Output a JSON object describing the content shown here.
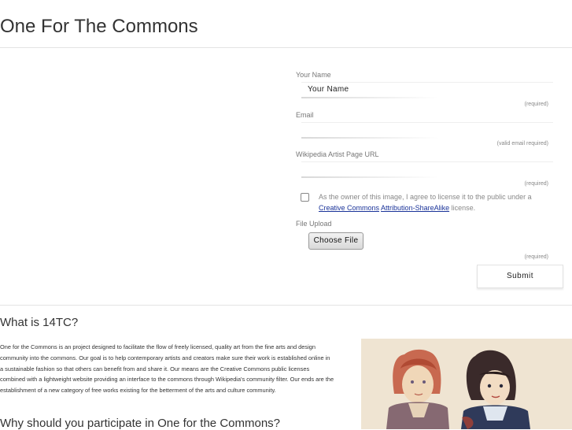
{
  "site": {
    "title": "One For The Commons"
  },
  "form": {
    "name_label": "Your Name",
    "name_value": "Your Name",
    "name_hint": "(required)",
    "email_label": "Email",
    "email_value": "",
    "email_hint": "(valid email required)",
    "wiki_label": "Wikipedia Artist Page URL",
    "wiki_value": "",
    "wiki_hint": "(required)",
    "consent_text_before": "As the owner of this image, I agree to license it to the public under a",
    "consent_link_1": "Creative Commons",
    "consent_link_2": "Attribution-ShareAlike",
    "consent_text_after": "license.",
    "upload_label": "File Upload",
    "upload_button": "Choose File",
    "upload_hint": "(required)",
    "submit_label": "Submit"
  },
  "about": {
    "heading": "What is 14TC?",
    "paragraph": "One for the Commons is an project designed to facilitate the flow of freely licensed, quality art from the fine arts and design community into the commons. Our goal is to help contemporary artists and creators make sure their work is established online in a sustainable fashion so that others can benefit from and share it. Our means are the Creative Commons public licenses combined with a lightweight website providing an interface to the commons through Wikipedia's community filter. Our ends are the establishment of a new category of free works existing for the betterment of the arts and culture community.",
    "why_heading": "Why should you participate in One for the Commons?"
  },
  "colors": {
    "link": "#1a3399",
    "rule": "#e3e3e3",
    "hint": "#888888"
  },
  "image": {
    "subject": "painting-two-children"
  }
}
